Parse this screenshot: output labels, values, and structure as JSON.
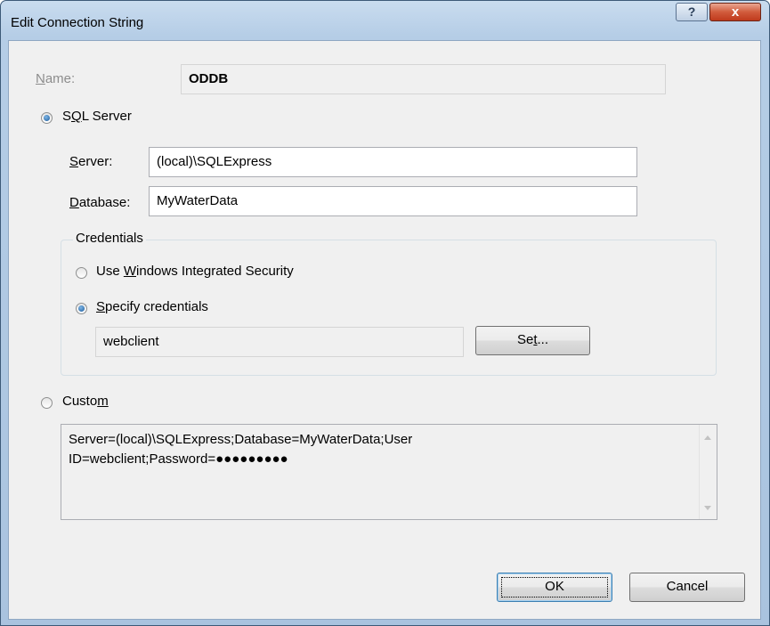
{
  "window": {
    "title": "Edit Connection String",
    "help_glyph": "?",
    "close_glyph": "x"
  },
  "name_row": {
    "label_underlined": "N",
    "label_rest": "ame:",
    "value": "ODDB"
  },
  "sql_server": {
    "label_pre": "S",
    "label_underlined": "Q",
    "label_post": "L Server",
    "selected": true,
    "server": {
      "label_underlined": "S",
      "label_rest": "erver:",
      "value": "(local)\\SQLExpress"
    },
    "database": {
      "label_underlined": "D",
      "label_rest": "atabase:",
      "value": "MyWaterData"
    }
  },
  "credentials": {
    "title": "Credentials",
    "integrated": {
      "label_pre": "Use ",
      "label_underlined": "W",
      "label_post": "indows Integrated Security",
      "selected": false
    },
    "specify": {
      "label_underlined": "S",
      "label_post": "pecify credentials",
      "selected": true
    },
    "username": "webclient",
    "set_button": {
      "label_pre": "Se",
      "label_underlined": "t",
      "label_post": "..."
    }
  },
  "custom": {
    "label_pre": "Custo",
    "label_underlined": "m",
    "selected": false,
    "line1": "Server=(local)\\SQLExpress;Database=MyWaterData;User",
    "line2": "ID=webclient;Password=●●●●●●●●●"
  },
  "buttons": {
    "ok": "OK",
    "cancel": "Cancel"
  },
  "colors": {
    "title_gradient_top": "#c9dcef",
    "client_bg": "#f0f0f0",
    "close_red": "#c94a2c",
    "radio_dot": "#1a5a9a"
  }
}
